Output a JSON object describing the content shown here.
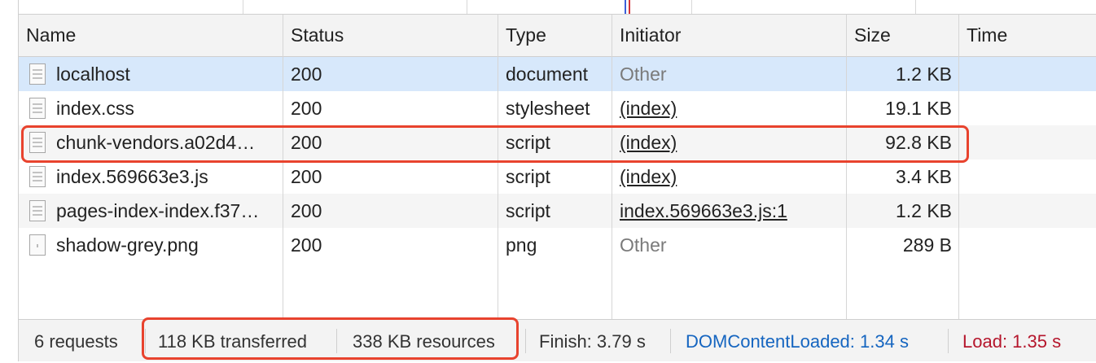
{
  "colors": {
    "selected_row": "#d7e8fb",
    "alt_row": "#f5f5f5",
    "highlight": "#e8432e",
    "dom_content_loaded": "#1565c0",
    "load": "#b5162c",
    "muted_text": "#7a7a7a"
  },
  "table": {
    "headers": {
      "name": "Name",
      "status": "Status",
      "type": "Type",
      "initiator": "Initiator",
      "size": "Size",
      "time": "Time"
    },
    "rows": [
      {
        "name": "localhost",
        "status": "200",
        "type": "document",
        "initiator": "Other",
        "size": "1.2 KB",
        "icon": "document-icon"
      },
      {
        "name": "index.css",
        "status": "200",
        "type": "stylesheet",
        "initiator": "(index)",
        "size": "19.1 KB",
        "icon": "document-icon"
      },
      {
        "name": "chunk-vendors.a02d4…",
        "status": "200",
        "type": "script",
        "initiator": "(index)",
        "size": "92.8 KB",
        "icon": "document-icon"
      },
      {
        "name": "index.569663e3.js",
        "status": "200",
        "type": "script",
        "initiator": "(index)",
        "size": "3.4 KB",
        "icon": "document-icon"
      },
      {
        "name": "pages-index-index.f37…",
        "status": "200",
        "type": "script",
        "initiator": "index.569663e3.js:1",
        "size": "1.2 KB",
        "icon": "document-icon"
      },
      {
        "name": "shadow-grey.png",
        "status": "200",
        "type": "png",
        "initiator": "Other",
        "size": "289 B",
        "icon": "image-file-icon"
      }
    ]
  },
  "status_bar": {
    "requests": "6 requests",
    "transferred": "118 KB transferred",
    "resources": "338 KB resources",
    "finish": "Finish: 3.79 s",
    "dom_content_loaded": "DOMContentLoaded: 1.34 s",
    "load": "Load: 1.35 s"
  }
}
